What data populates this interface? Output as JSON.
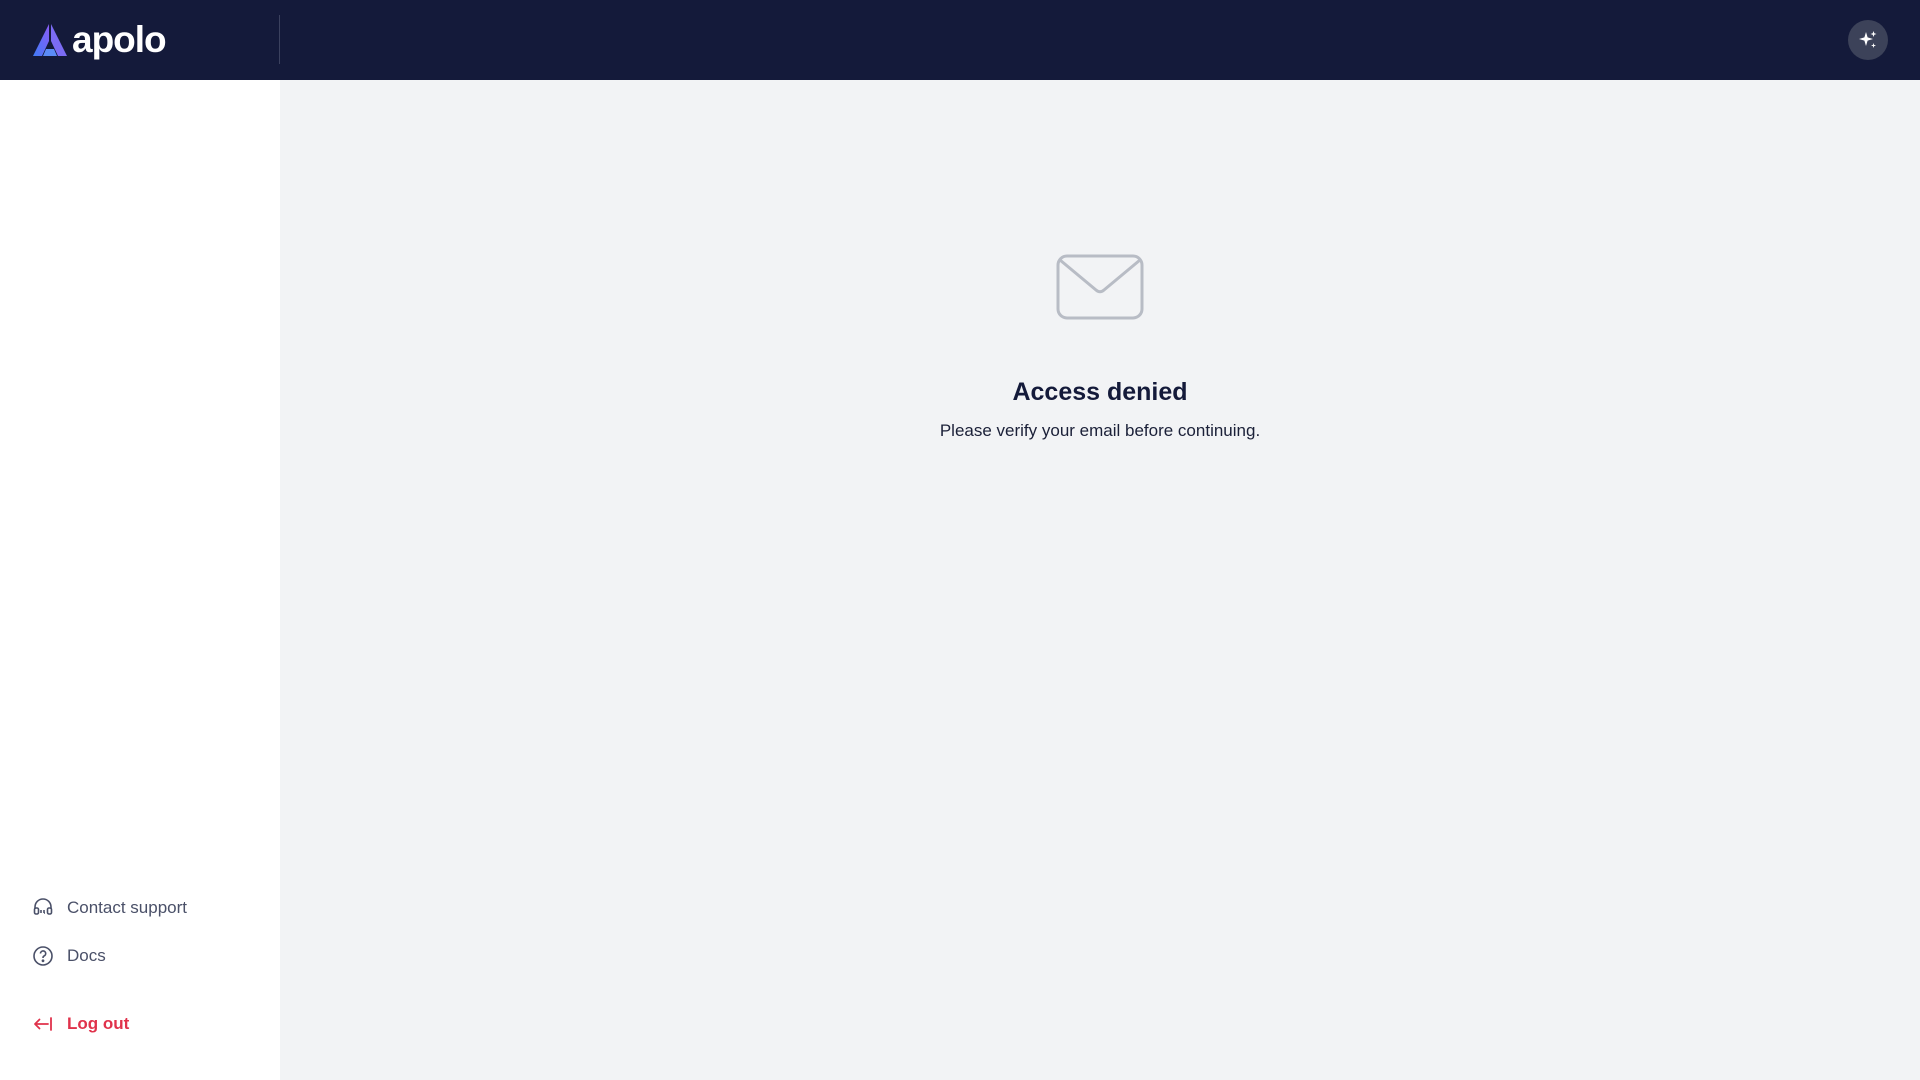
{
  "header": {
    "logo_text": "apolo",
    "logo_icon": "apolo-triangle-logo",
    "ai_button_icon": "sparkles-icon"
  },
  "sidebar": {
    "items": [
      {
        "label": "Contact support",
        "icon": "headset-icon"
      },
      {
        "label": "Docs",
        "icon": "help-circle-icon"
      },
      {
        "label": "Log out",
        "icon": "logout-arrow-icon"
      }
    ]
  },
  "main": {
    "icon": "envelope-icon",
    "title": "Access denied",
    "message": "Please verify your email before continuing."
  },
  "colors": {
    "header_bg": "#141a3a",
    "main_bg": "#f2f3f5",
    "sidebar_bg": "#ffffff",
    "logout": "#e0324b",
    "icon_gray": "#b8bcc5"
  }
}
